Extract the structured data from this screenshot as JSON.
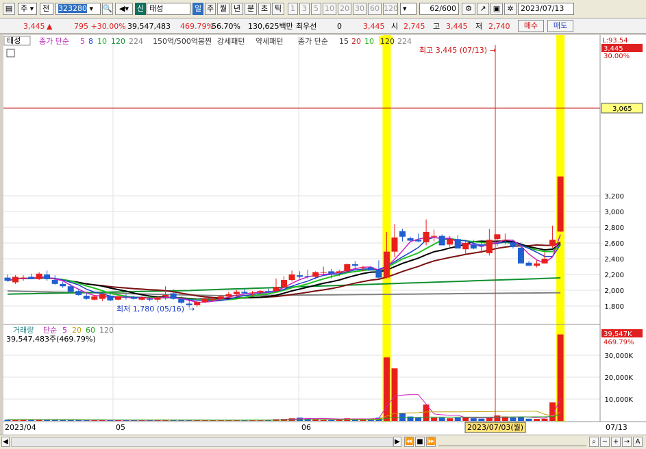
{
  "toolbar": {
    "market": "주",
    "period_type": "전",
    "code": "323280",
    "badge": "신",
    "name": "태성",
    "periods": [
      "일",
      "주",
      "월",
      "년",
      "분",
      "초",
      "틱"
    ],
    "selected_period": "일",
    "nums": [
      "1",
      "3",
      "5",
      "10",
      "20",
      "30",
      "60",
      "120"
    ],
    "count": "62",
    "total": "/600",
    "date": "2023/07/13"
  },
  "quote": {
    "price": "3,445",
    "arrow": "▲",
    "change": "795 +30.00%",
    "volume": "39,547,483",
    "vol_ratio": "469.79%",
    "turnover": "56.70%",
    "amount": "130,625백만",
    "pref_label": "최우선",
    "pref_value": "0",
    "pref_price": "3,445",
    "open_label": "시",
    "open": "2,745",
    "high_label": "고",
    "high": "3,445",
    "low_label": "저",
    "low": "2,740",
    "buy": "매수",
    "sell": "매도"
  },
  "price_panel": {
    "name_tag": "태성",
    "legend1_label": "종가 단순",
    "legend1_periods": [
      "5",
      "8",
      "10",
      "120",
      "224"
    ],
    "legend2": "150억/500억봉찐",
    "legend3": "강세패턴",
    "legend4": "약세패턴",
    "legend5_label": "종가 단순",
    "legend5_periods": [
      "15",
      "20",
      "10",
      "120",
      "224"
    ],
    "high_note": "최고 3,445 (07/13)",
    "low_note": "최저 1,780 (05/16)",
    "right_top": "L:93.54",
    "right_price": "3,445",
    "right_pct": "30.00%",
    "hline_label": "3,065",
    "y_ticks": [
      "3,200",
      "3,000",
      "2,800",
      "2,600",
      "2,400",
      "2,200",
      "2,000",
      "1,800"
    ]
  },
  "volume_panel": {
    "label": "거래량",
    "ma_label": "단순",
    "ma_periods": [
      "5",
      "20",
      "60",
      "120"
    ],
    "value": "39,547,483주(469.79%)",
    "right_vol": "39,547K",
    "right_pct": "469.79%",
    "y_ticks": [
      "30,000K",
      "20,000K",
      "10,000K"
    ]
  },
  "x_axis": {
    "labels": [
      "2023/04",
      "05",
      "06"
    ],
    "right_label": "07/13",
    "cursor_label": "2023/07/03(월)"
  },
  "colors": {
    "up": "#e8201c",
    "down": "#1f5fd0",
    "highlight": "#ffff00",
    "ma5": "#d020c0",
    "ma8": "#2040d0",
    "ma10": "#20c020",
    "ma20": "#000000",
    "ma60": "#7a1010",
    "ma120": "#109030",
    "ma224": "#808080"
  },
  "chart_data": {
    "type": "candlestick",
    "ylim": [
      1700,
      3300
    ],
    "candles": [
      [
        2160,
        2200,
        2110,
        2120
      ],
      [
        2100,
        2190,
        2080,
        2170
      ],
      [
        2150,
        2190,
        2120,
        2160
      ],
      [
        2170,
        2210,
        2140,
        2140
      ],
      [
        2140,
        2230,
        2130,
        2210
      ],
      [
        2200,
        2250,
        2120,
        2140
      ],
      [
        2130,
        2190,
        2070,
        2080
      ],
      [
        2080,
        2110,
        2030,
        2050
      ],
      [
        2050,
        2080,
        1970,
        1980
      ],
      [
        1990,
        2010,
        1930,
        1940
      ],
      [
        1930,
        1960,
        1880,
        1890
      ],
      [
        1880,
        1940,
        1870,
        1920
      ],
      [
        1890,
        1950,
        1860,
        1950
      ],
      [
        1930,
        1960,
        1860,
        1870
      ],
      [
        1880,
        1930,
        1870,
        1920
      ],
      [
        1920,
        1950,
        1880,
        1910
      ],
      [
        1910,
        1930,
        1880,
        1890
      ],
      [
        1880,
        1920,
        1870,
        1910
      ],
      [
        1890,
        1930,
        1860,
        1880
      ],
      [
        1880,
        1930,
        1850,
        1910
      ],
      [
        1920,
        2050,
        1880,
        1940
      ],
      [
        1960,
        2010,
        1880,
        1890
      ],
      [
        1890,
        1920,
        1830,
        1840
      ],
      [
        1830,
        1870,
        1780,
        1810
      ],
      [
        1810,
        1860,
        1790,
        1850
      ],
      [
        1850,
        1920,
        1840,
        1890
      ],
      [
        1880,
        1910,
        1860,
        1890
      ],
      [
        1890,
        1940,
        1880,
        1920
      ],
      [
        1920,
        1980,
        1900,
        1950
      ],
      [
        1950,
        2000,
        1920,
        1980
      ],
      [
        1980,
        2010,
        1950,
        1960
      ],
      [
        1960,
        1990,
        1930,
        1970
      ],
      [
        1970,
        2000,
        1950,
        1990
      ],
      [
        1990,
        2020,
        1970,
        1980
      ],
      [
        1990,
        2150,
        1980,
        2040
      ],
      [
        2040,
        2180,
        2030,
        2130
      ],
      [
        2130,
        2250,
        2110,
        2200
      ],
      [
        2190,
        2240,
        2150,
        2170
      ],
      [
        2180,
        2260,
        2150,
        2170
      ],
      [
        2170,
        2240,
        2140,
        2230
      ],
      [
        2230,
        2300,
        2180,
        2230
      ],
      [
        2240,
        2270,
        2150,
        2210
      ],
      [
        2220,
        2260,
        2180,
        2240
      ],
      [
        2240,
        2340,
        2230,
        2330
      ],
      [
        2330,
        2370,
        2250,
        2310
      ],
      [
        2290,
        2310,
        2240,
        2290
      ],
      [
        2290,
        2310,
        2250,
        2250
      ],
      [
        2260,
        2380,
        2150,
        2160
      ],
      [
        2160,
        2740,
        2150,
        2490
      ],
      [
        2490,
        2840,
        2420,
        2670
      ],
      [
        2750,
        2780,
        2620,
        2680
      ],
      [
        2660,
        2680,
        2620,
        2630
      ],
      [
        2640,
        2720,
        2610,
        2620
      ],
      [
        2610,
        2900,
        2570,
        2740
      ],
      [
        2680,
        2770,
        2620,
        2690
      ],
      [
        2690,
        2710,
        2600,
        2570
      ],
      [
        2580,
        2690,
        2550,
        2650
      ],
      [
        2650,
        2700,
        2530,
        2530
      ],
      [
        2520,
        2640,
        2460,
        2600
      ],
      [
        2580,
        2640,
        2520,
        2530
      ],
      [
        2580,
        2620,
        2470,
        2560
      ],
      [
        2470,
        2780,
        2440,
        2640
      ],
      [
        2650,
        2710,
        2560,
        2710
      ],
      [
        2640,
        2720,
        2580,
        2640
      ],
      [
        2600,
        2640,
        2530,
        2550
      ],
      [
        2540,
        2610,
        2350,
        2340
      ],
      [
        2350,
        2370,
        2310,
        2310
      ],
      [
        2310,
        2380,
        2290,
        2340
      ],
      [
        2340,
        2480,
        2340,
        2400
      ],
      [
        2560,
        2820,
        2540,
        2640
      ],
      [
        2745,
        3445,
        2740,
        3445
      ]
    ],
    "volume": [
      0.6,
      0.5,
      0.7,
      0.6,
      0.5,
      0.6,
      0.5,
      0.4,
      0.5,
      0.4,
      0.3,
      0.4,
      0.3,
      0.3,
      0.4,
      0.3,
      0.3,
      0.3,
      0.3,
      0.4,
      0.5,
      0.4,
      0.4,
      0.3,
      0.3,
      0.3,
      0.3,
      0.3,
      0.4,
      0.3,
      0.3,
      0.3,
      0.4,
      0.5,
      0.8,
      0.9,
      1.2,
      1.5,
      1.1,
      0.9,
      0.8,
      0.8,
      0.9,
      1.2,
      1.0,
      0.8,
      0.9,
      1.5,
      29.0,
      24.0,
      3.5,
      2.0,
      1.5,
      7.5,
      1.5,
      1.5,
      1.2,
      1.5,
      1.8,
      1.2,
      1.0,
      1.5,
      2.5,
      2.0,
      1.5,
      1.8,
      1.0,
      0.9,
      1.0,
      8.5,
      39.5
    ]
  }
}
